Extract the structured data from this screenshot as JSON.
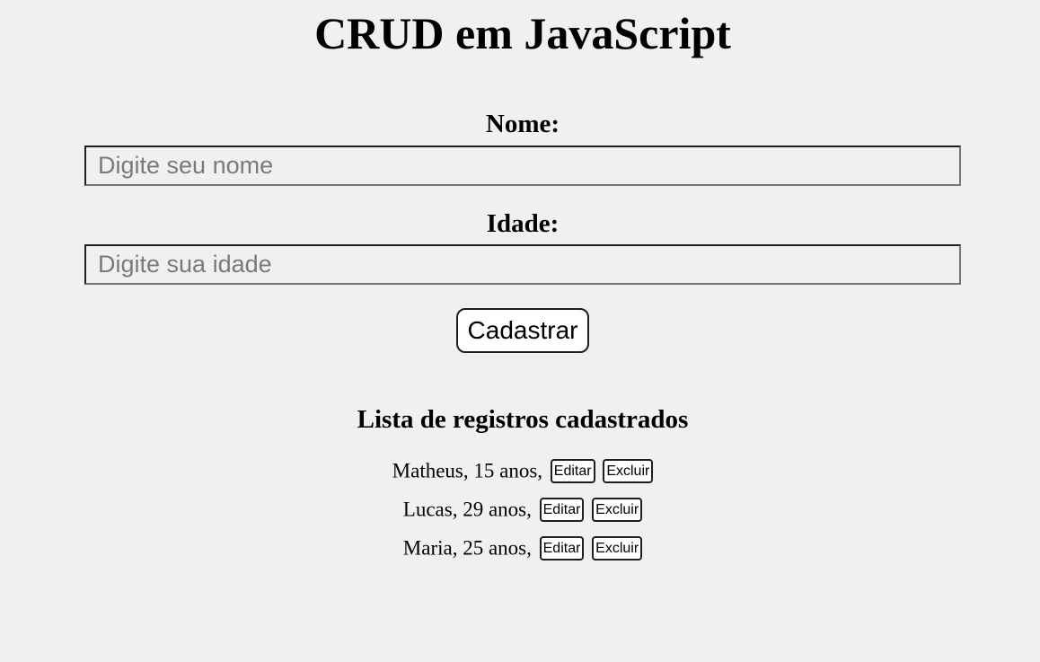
{
  "page": {
    "title": "CRUD em JavaScript"
  },
  "form": {
    "name_label": "Nome:",
    "name_placeholder": "Digite seu nome",
    "name_value": "",
    "age_label": "Idade:",
    "age_placeholder": "Digite sua idade",
    "age_value": "",
    "submit_label": "Cadastrar"
  },
  "list": {
    "title": "Lista de registros cadastrados",
    "edit_label": "Editar",
    "delete_label": "Excluir",
    "records": [
      {
        "text": "Matheus, 15 anos,"
      },
      {
        "text": "Lucas, 29 anos,"
      },
      {
        "text": "Maria, 25 anos,"
      }
    ]
  }
}
